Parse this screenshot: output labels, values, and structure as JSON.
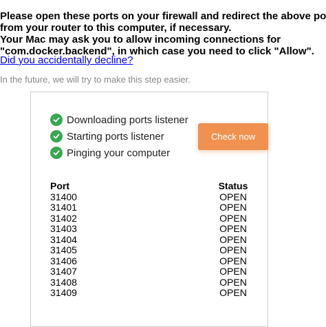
{
  "intro": {
    "lines": [
      "Please open these ports on your firewall and redirect the above ports",
      "from your router to this computer, if necessary.",
      "Your Mac may ask you to allow incoming connections for",
      "\"com.docker.backend\", in which case you need to click \"Allow\"."
    ]
  },
  "decline_link": "Did you accidentally decline?",
  "future_note": "In the future, we will try to make this step easier.",
  "steps": [
    {
      "label": "Downloading ports listener",
      "icon": "check-circle-icon"
    },
    {
      "label": "Starting ports listener",
      "icon": "check-circle-icon"
    },
    {
      "label": "Pinging your computer",
      "icon": "check-circle-icon"
    }
  ],
  "check_button": "Check now",
  "colors": {
    "accent": "#f0914f",
    "success": "#36a850",
    "link": "#0000ee",
    "muted": "#888888"
  },
  "ports_table": {
    "headers": {
      "port": "Port",
      "status": "Status"
    },
    "rows": [
      {
        "port": "31400",
        "status": "OPEN"
      },
      {
        "port": "31401",
        "status": "OPEN"
      },
      {
        "port": "31402",
        "status": "OPEN"
      },
      {
        "port": "31403",
        "status": "OPEN"
      },
      {
        "port": "31404",
        "status": "OPEN"
      },
      {
        "port": "31405",
        "status": "OPEN"
      },
      {
        "port": "31406",
        "status": "OPEN"
      },
      {
        "port": "31407",
        "status": "OPEN"
      },
      {
        "port": "31408",
        "status": "OPEN"
      },
      {
        "port": "31409",
        "status": "OPEN"
      }
    ]
  }
}
